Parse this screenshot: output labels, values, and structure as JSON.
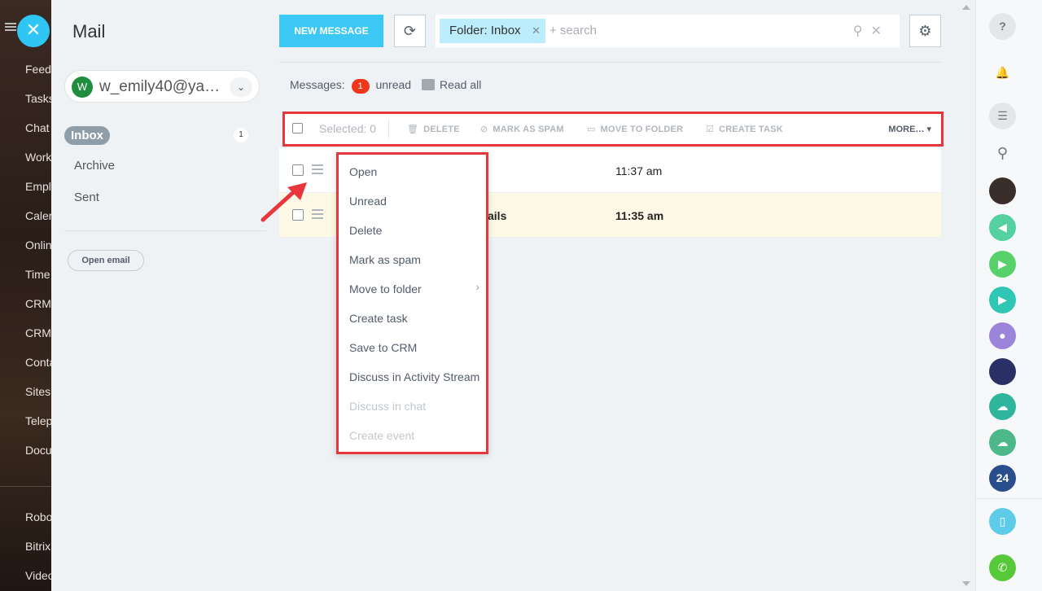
{
  "leftnav": {
    "items": [
      "Feed",
      "Tasks",
      "Chat",
      "Workgroups",
      "Employees",
      "Calendar",
      "Online",
      "Time",
      "CRM",
      "CRM",
      "Contacts",
      "Sites",
      "Telephony",
      "Documents",
      "Robots",
      "Bitrix",
      "Video"
    ]
  },
  "mail": {
    "title": "Mail",
    "account_initial": "W",
    "account_email": "w_emily40@ya…",
    "folders": [
      {
        "label": "Inbox",
        "count": "1"
      },
      {
        "label": "Archive"
      },
      {
        "label": "Sent"
      }
    ],
    "open_email_label": "Open email"
  },
  "header": {
    "new_message_label": "NEW MESSAGE",
    "filter_chip": "Folder: Inbox",
    "search_placeholder": "+ search"
  },
  "summary": {
    "messages_label": "Messages:",
    "unread_count": "1",
    "unread_label": "unread",
    "read_all_label": "Read all"
  },
  "toolbar": {
    "selected_label": "Selected: 0",
    "delete_label": "DELETE",
    "spam_label": "MARK AS SPAM",
    "move_label": "MOVE TO FOLDER",
    "task_label": "CREATE TASK",
    "more_label": "MORE…"
  },
  "rows": [
    {
      "subject": "",
      "time": "11:37 am"
    },
    {
      "subject": "ails",
      "time": "11:35 am"
    }
  ],
  "context_menu": {
    "items": [
      "Open",
      "Unread",
      "Delete",
      "Mark as spam",
      "Move to folder",
      "Create task",
      "Save to CRM",
      "Discuss in Activity Stream",
      "Discuss in chat",
      "Create event"
    ]
  },
  "rightbar": {
    "badge_24": "24"
  },
  "colors": {
    "accent": "#3bc8f5",
    "highlight_border": "#e8363c",
    "unread_row": "#fdf9e6"
  }
}
